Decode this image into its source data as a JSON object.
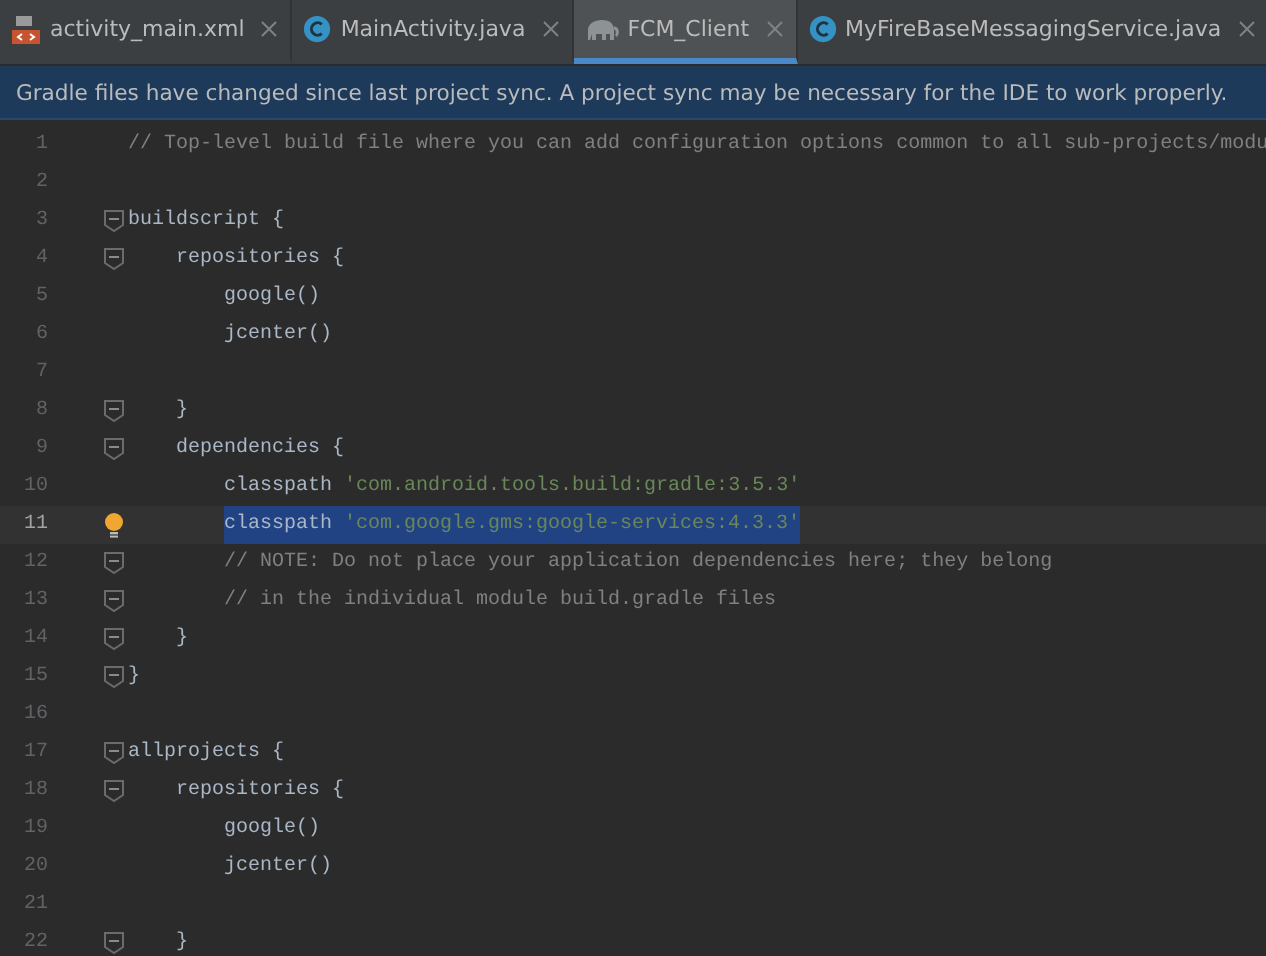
{
  "tabs": [
    {
      "label": "activity_main.xml",
      "kind": "xml",
      "selected": false
    },
    {
      "label": "MainActivity.java",
      "kind": "class",
      "selected": false
    },
    {
      "label": "FCM_Client",
      "kind": "gradle",
      "selected": true
    },
    {
      "label": "MyFireBaseMessagingService.java",
      "kind": "class",
      "selected": false
    }
  ],
  "banner": "Gradle files have changed since last project sync. A project sync may be necessary for the IDE to work properly.",
  "lines": [
    {
      "number": "1",
      "fold": false,
      "current": false,
      "bulb": false,
      "segments": [
        {
          "kind": "comment",
          "text": "// Top-level build file where you can add configuration options common to all sub-projects/modu"
        }
      ]
    },
    {
      "number": "2",
      "fold": false,
      "current": false,
      "bulb": false
    },
    {
      "number": "3",
      "fold": true,
      "current": false,
      "bulb": false,
      "segments": [
        {
          "kind": "plain",
          "text": "buildscript {"
        }
      ]
    },
    {
      "number": "4",
      "fold": true,
      "current": false,
      "bulb": false,
      "segments": [
        {
          "kind": "plain",
          "text": "    repositories {"
        }
      ]
    },
    {
      "number": "5",
      "fold": false,
      "current": false,
      "bulb": false,
      "segments": [
        {
          "kind": "plain",
          "text": "        google()"
        }
      ]
    },
    {
      "number": "6",
      "fold": false,
      "current": false,
      "bulb": false,
      "segments": [
        {
          "kind": "plain",
          "text": "        jcenter()"
        }
      ]
    },
    {
      "number": "7",
      "fold": false,
      "current": false,
      "bulb": false
    },
    {
      "number": "8",
      "fold": true,
      "current": false,
      "bulb": false,
      "segments": [
        {
          "kind": "plain",
          "text": "    }"
        }
      ]
    },
    {
      "number": "9",
      "fold": true,
      "current": false,
      "bulb": false,
      "segments": [
        {
          "kind": "plain",
          "text": "    dependencies {"
        }
      ]
    },
    {
      "number": "10",
      "fold": false,
      "current": false,
      "bulb": false,
      "segments": [
        {
          "kind": "plain",
          "text": "        classpath "
        },
        {
          "kind": "string",
          "text": "'com.android.tools.build:gradle:3.5.3'"
        }
      ]
    },
    {
      "number": "11",
      "fold": false,
      "current": true,
      "bulb": true,
      "indented": true,
      "segments": [
        {
          "kind": "selected",
          "text": "classpath "
        },
        {
          "kind": "selected-string",
          "text": "'com.google.gms:google-services:4.3.3'"
        }
      ]
    },
    {
      "number": "12",
      "fold": true,
      "current": false,
      "bulb": false,
      "segments": [
        {
          "kind": "comment",
          "text": "        // NOTE: Do not place your application dependencies here; they belong"
        }
      ]
    },
    {
      "number": "13",
      "fold": true,
      "current": false,
      "bulb": false,
      "segments": [
        {
          "kind": "comment",
          "text": "        // in the individual module build.gradle files"
        }
      ]
    },
    {
      "number": "14",
      "fold": true,
      "current": false,
      "bulb": false,
      "segments": [
        {
          "kind": "plain",
          "text": "    }"
        }
      ]
    },
    {
      "number": "15",
      "fold": true,
      "current": false,
      "bulb": false,
      "segments": [
        {
          "kind": "plain",
          "text": "}"
        }
      ]
    },
    {
      "number": "16",
      "fold": false,
      "current": false,
      "bulb": false
    },
    {
      "number": "17",
      "fold": true,
      "current": false,
      "bulb": false,
      "segments": [
        {
          "kind": "plain",
          "text": "allprojects {"
        }
      ]
    },
    {
      "number": "18",
      "fold": true,
      "current": false,
      "bulb": false,
      "segments": [
        {
          "kind": "plain",
          "text": "    repositories {"
        }
      ]
    },
    {
      "number": "19",
      "fold": false,
      "current": false,
      "bulb": false,
      "segments": [
        {
          "kind": "plain",
          "text": "        google()"
        }
      ]
    },
    {
      "number": "20",
      "fold": false,
      "current": false,
      "bulb": false,
      "segments": [
        {
          "kind": "plain",
          "text": "        jcenter()"
        }
      ]
    },
    {
      "number": "21",
      "fold": false,
      "current": false,
      "bulb": false
    },
    {
      "number": "22",
      "fold": true,
      "current": false,
      "bulb": false,
      "segments": [
        {
          "kind": "plain",
          "text": "    }"
        }
      ]
    }
  ]
}
